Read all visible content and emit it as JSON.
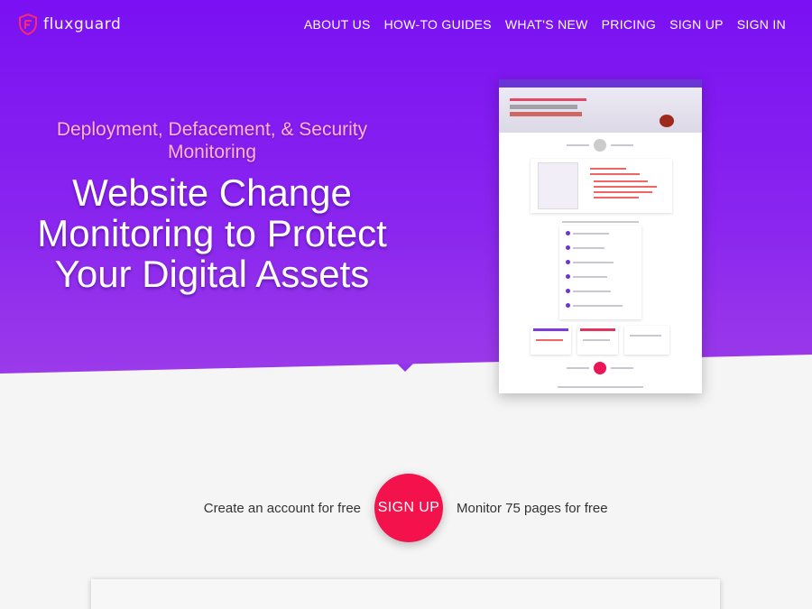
{
  "brand": {
    "name": "fluxguard",
    "logo_icon": "shield-f-icon",
    "accent": "#f3124c"
  },
  "nav": {
    "items": [
      {
        "label": "ABOUT US"
      },
      {
        "label": "HOW-TO GUIDES"
      },
      {
        "label": "WHAT'S NEW"
      },
      {
        "label": "PRICING"
      },
      {
        "label": "SIGN UP"
      },
      {
        "label": "SIGN IN"
      }
    ]
  },
  "hero": {
    "tagline": "Deployment, Defacement, & Security Monitoring",
    "headline": "Website Change Monitoring to Protect Your Digital Assets",
    "background": "#7a10f3"
  },
  "preview": {
    "description_icon": "site-screenshot-thumbnail"
  },
  "signup": {
    "left_text": "Create an account for free",
    "button_label": "SIGN UP",
    "right_text": "Monitor 75 pages for free"
  }
}
